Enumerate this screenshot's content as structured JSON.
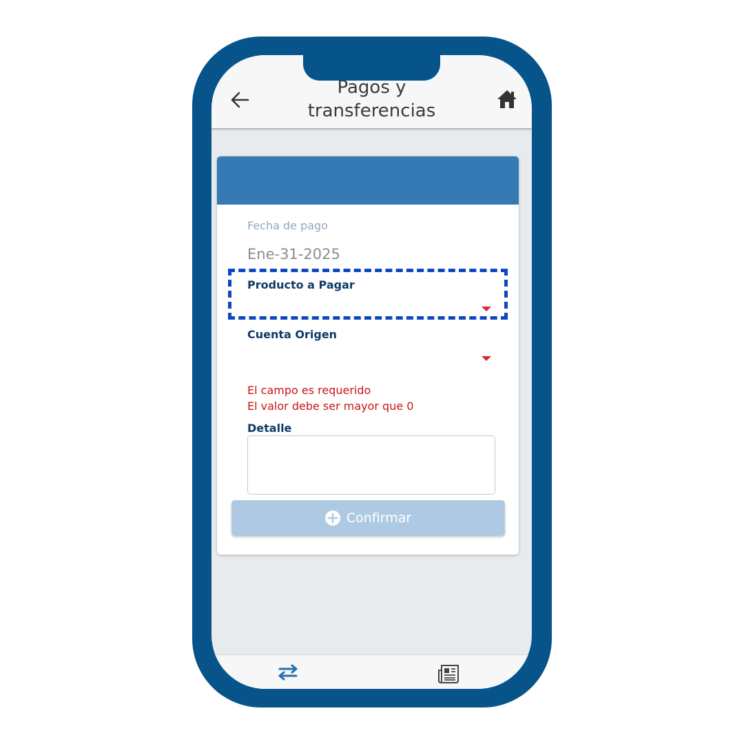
{
  "header": {
    "title": "Pagos y transferencias",
    "back_icon": "back-arrow-icon",
    "home_icon": "home-icon"
  },
  "form": {
    "fecha_label": "Fecha de pago",
    "fecha_value": "Ene-31-2025",
    "producto_label": "Producto a Pagar",
    "producto_value": "",
    "cuenta_label": "Cuenta Origen",
    "cuenta_value": "",
    "errors": [
      "El campo es requerido",
      "El valor debe ser mayor que 0"
    ],
    "detalle_label": "Detalle",
    "detalle_value": "",
    "confirm_label": "Confirmar"
  },
  "bottom_nav": {
    "items": [
      {
        "icon": "transfer-arrows-icon"
      },
      {
        "icon": "newspaper-icon"
      }
    ]
  },
  "colors": {
    "frame": "#07548a",
    "card_header": "#3579b5",
    "label": "#0f3a68",
    "error": "#c81414",
    "button_disabled": "#aecae3",
    "highlight": "#0d47c4",
    "caret": "#d42b2b"
  }
}
